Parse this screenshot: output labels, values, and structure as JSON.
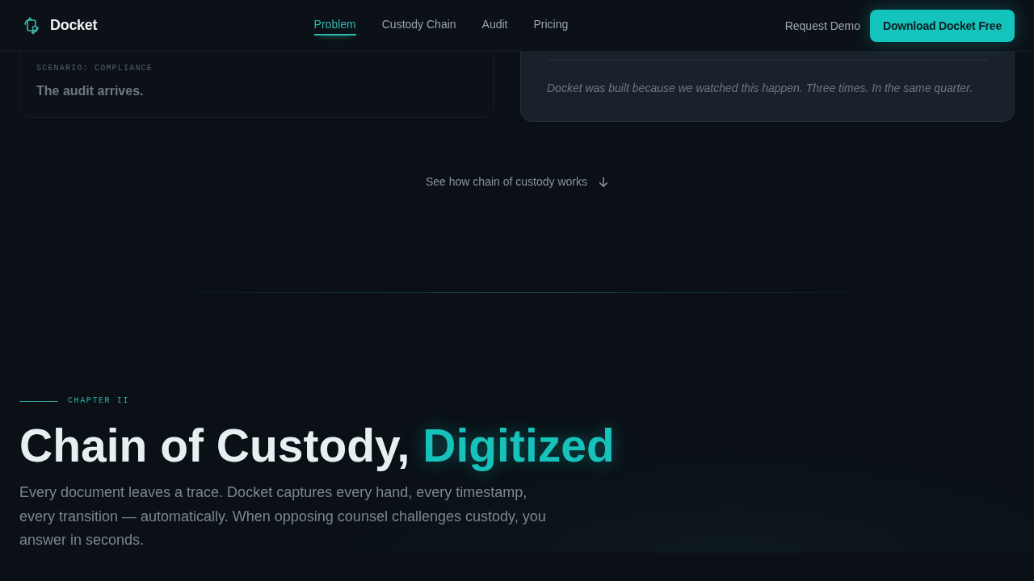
{
  "header": {
    "brand": "Docket",
    "nav": [
      {
        "label": "Problem",
        "selected": true
      },
      {
        "label": "Custody Chain",
        "selected": false
      },
      {
        "label": "Audit",
        "selected": false
      },
      {
        "label": "Pricing",
        "selected": false
      }
    ],
    "actions": [
      {
        "kind": "link",
        "label": "Request Demo"
      },
      {
        "kind": "primary",
        "label": "Download Docket Free"
      }
    ]
  },
  "scenario_cards": [
    {
      "kind": "plain",
      "eyebrow": "SCENARIO: COMPLIANCE",
      "title": "The audit arrives."
    },
    {
      "kind": "highlight",
      "quote": "Docket was built because we watched this happen. Three times. In the same quarter."
    }
  ],
  "scroll_link": {
    "label": "See how chain of custody works"
  },
  "chapter": {
    "eyebrow": "CHAPTER II",
    "title": "Chain of Custody,",
    "highlight": "Digitized",
    "body": "Every document leaves a trace. Docket captures every hand, every timestamp, every transition — automatically. When opposing counsel challenges custody, you answer in seconds."
  }
}
